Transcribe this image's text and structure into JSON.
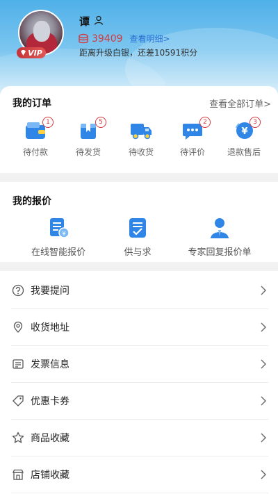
{
  "profile": {
    "name": "谭",
    "vip_label": "VIP",
    "points": "39409",
    "detail_link": "查看明细>",
    "upgrade_text": "距离升级白银，还差10591积分"
  },
  "orders": {
    "title": "我的订单",
    "view_all": "查看全部订单>",
    "items": [
      {
        "label": "待付款",
        "badge": "1",
        "icon": "wallet-icon"
      },
      {
        "label": "待发货",
        "badge": "5",
        "icon": "package-icon"
      },
      {
        "label": "待收货",
        "badge": "",
        "icon": "truck-icon"
      },
      {
        "label": "待评价",
        "badge": "2",
        "icon": "chat-bubble-icon"
      },
      {
        "label": "退款售后",
        "badge": "3",
        "icon": "refund-yen-icon"
      }
    ]
  },
  "quotes": {
    "title": "我的报价",
    "items": [
      {
        "label": "在线智能报价",
        "icon": "quote-document-icon"
      },
      {
        "label": "供与求",
        "icon": "supply-demand-icon"
      },
      {
        "label": "专家回复报价单",
        "icon": "expert-icon"
      }
    ]
  },
  "menu": {
    "items": [
      {
        "label": "我要提问",
        "icon": "question-icon"
      },
      {
        "label": "收货地址",
        "icon": "location-icon"
      },
      {
        "label": "发票信息",
        "icon": "invoice-icon"
      },
      {
        "label": "优惠卡券",
        "icon": "coupon-tag-icon"
      },
      {
        "label": "商品收藏",
        "icon": "star-icon"
      },
      {
        "label": "店铺收藏",
        "icon": "store-icon"
      }
    ]
  },
  "colors": {
    "accent_blue": "#2f86e6",
    "badge_red": "#d6373c",
    "header_blue": "#4fb0e8"
  }
}
